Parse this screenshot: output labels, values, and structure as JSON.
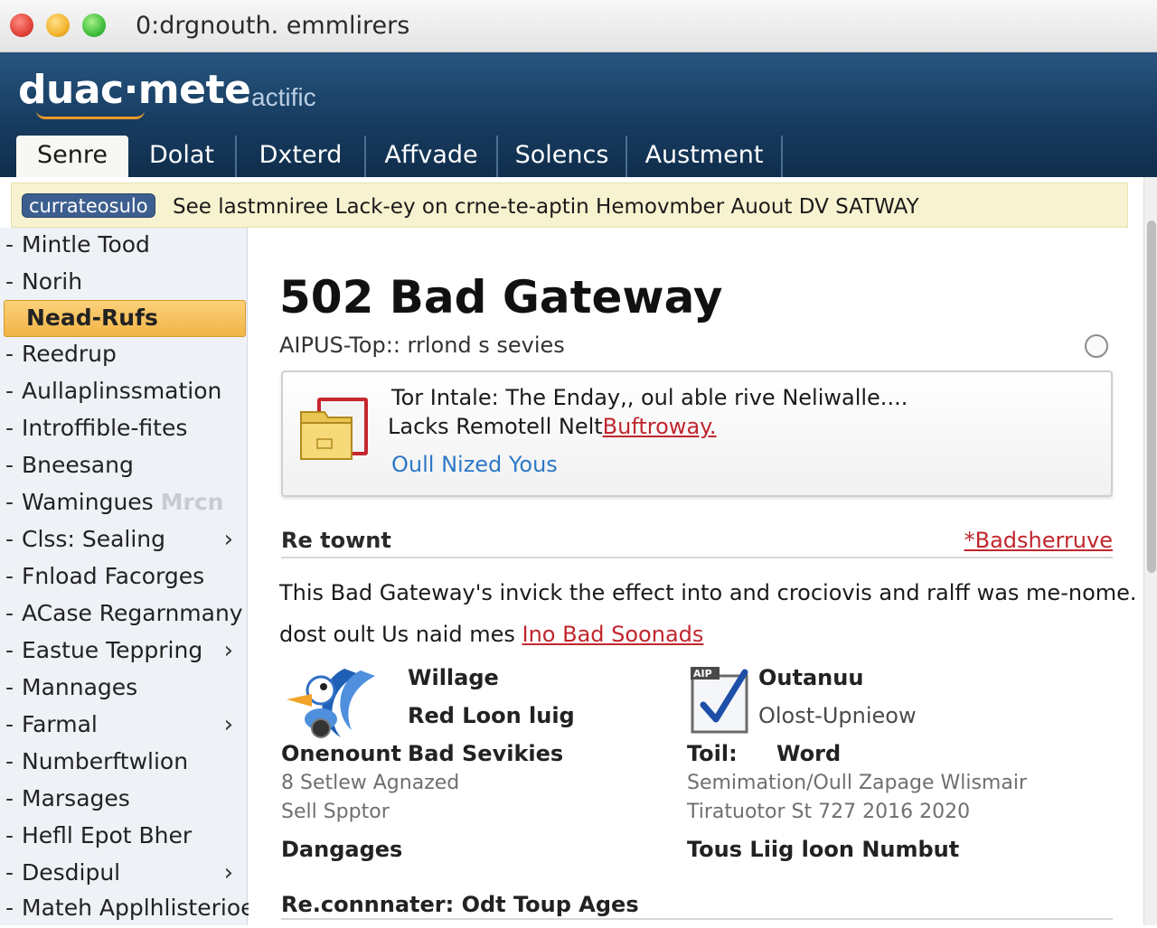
{
  "window": {
    "title": "0:drgnouth. emmlirers"
  },
  "header": {
    "logo": "duac·mete",
    "logo_sub": "actific",
    "tabs": [
      {
        "label": "Senre",
        "active": true
      },
      {
        "label": "Dolat"
      },
      {
        "label": "Dxterd"
      },
      {
        "label": "Affvade"
      },
      {
        "label": "Solencs"
      },
      {
        "label": "Austment"
      }
    ]
  },
  "notice": {
    "badge": "currateosulo",
    "text": "See lastmniree Lack-ey on crne-te-aptin Hemovmber Auout DV SATWAY"
  },
  "sidebar": {
    "items": [
      {
        "label": "Mintle Tood"
      },
      {
        "label": "Norih"
      },
      {
        "label": "Nead-Rufs",
        "active": true
      },
      {
        "label": "Reedrup"
      },
      {
        "label": "Aullaplinssmation"
      },
      {
        "label": "Introffible-fites"
      },
      {
        "label": "Bneesang"
      },
      {
        "label": "Wamingues",
        "faded": "Mrcn"
      },
      {
        "label": "Clss: Sealing",
        "chevron": "›"
      },
      {
        "label": "Fnload Facorges"
      },
      {
        "label": "ACase Regarnmany"
      },
      {
        "label": "Eastue Teppring",
        "chevron": "›"
      },
      {
        "label": "Mannages"
      },
      {
        "label": "Farmal",
        "chevron": "›"
      },
      {
        "label": "Numberftwlion"
      },
      {
        "label": "Marsages"
      },
      {
        "label": "Hefll Epot Bher"
      },
      {
        "label": "Desdipul",
        "chevron": "›"
      },
      {
        "label": "Mateh Applhlisterioe"
      }
    ]
  },
  "main": {
    "title": "502 Bad Gateway",
    "subtitle": "AIPUS-Top:: rrlond s sevies",
    "card": {
      "line1": "Tor Intale: The Enday,, oul able rive Neliwalle....",
      "line2_prefix": "Lacks Remotell Nelt",
      "line2_link": "Buftroway.",
      "line3": "Oull Nized Yous"
    },
    "section": {
      "title": "Re townt",
      "link": "*Badsherruve"
    },
    "paragraph": {
      "line1": "This Bad Gateway's invick the effect into and crociovis and ralff was me-nome.",
      "line2_prefix": "dost oult Us naid mes ",
      "line2_link": "Ino Bad Soonads"
    },
    "info_left": {
      "title1": "Willage",
      "title2": "Red Loon luig",
      "label": "Onenount",
      "value": "Bad Sevikies",
      "detail1": "8 Setlew Agnazed",
      "detail2": "Sell Spptor",
      "footer": "Dangages"
    },
    "info_right": {
      "badge": "AIP",
      "title1": "Outanuu",
      "title2": "Olost-Upnieow",
      "label": "Toil:",
      "value": "Word",
      "detail1": "Semimation/Oull Zapage Wlismair",
      "detail2": "Tiratuotor St 727 2016 2020",
      "footer": "Tous Liig loon Numbut"
    },
    "bottom_heading": "Re.connnater: Odt Toup Ages"
  },
  "colors": {
    "header": "#163a5e",
    "active_sidebar": "#f2b445",
    "link_red": "#c0262d",
    "link_blue": "#2d78c8",
    "notice_bg": "#f7f3d0"
  }
}
